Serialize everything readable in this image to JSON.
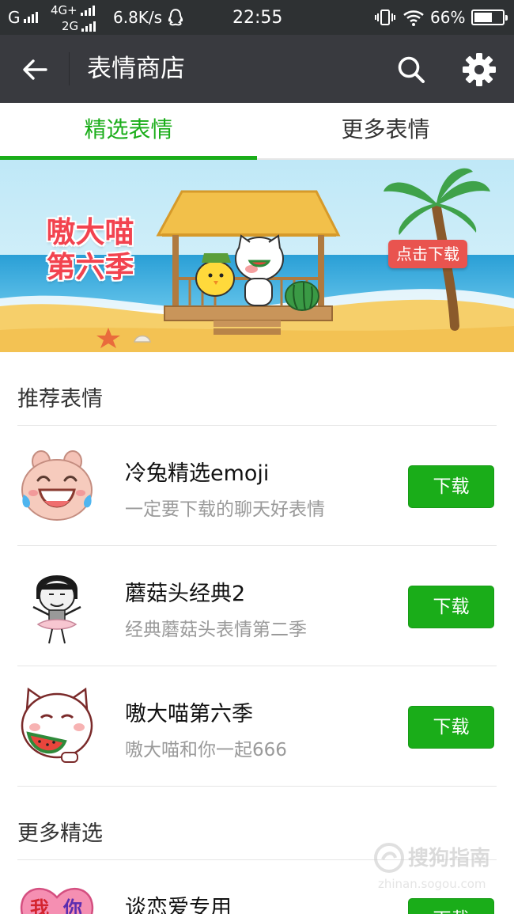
{
  "status_bar": {
    "carrier1": "G",
    "net_top": "4G+",
    "net_bottom": "2G",
    "speed": "6.8K/s",
    "time": "22:55",
    "battery": "66%",
    "battery_level": 0.66
  },
  "app_bar": {
    "title": "表情商店",
    "back_icon": "arrow-left-icon",
    "search_icon": "search-icon",
    "settings_icon": "gear-icon"
  },
  "tabs": [
    {
      "label": "精选表情",
      "active": true
    },
    {
      "label": "更多表情",
      "active": false
    }
  ],
  "banner": {
    "title_line1": "嗷大喵",
    "title_line2": "第六季",
    "cta": "点击下载"
  },
  "sections": {
    "recommended": "推荐表情",
    "more": "更多精选"
  },
  "items": [
    {
      "name": "冷兔精选emoji",
      "desc": "一定要下载的聊天好表情",
      "button": "下载"
    },
    {
      "name": "蘑菇头经典2",
      "desc": "经典蘑菇头表情第二季",
      "button": "下载"
    },
    {
      "name": "嗷大喵第六季",
      "desc": "嗷大喵和你一起666",
      "button": "下载"
    },
    {
      "name": "谈恋爱专用",
      "desc": "",
      "button": "下载"
    }
  ],
  "watermark": {
    "text": "搜狗指南",
    "url": "zhinan.sogou.com"
  },
  "colors": {
    "accent": "#1aad19",
    "app_bar": "#393a3f",
    "status_bar": "#2e3133",
    "banner_red": "#f2434f"
  }
}
